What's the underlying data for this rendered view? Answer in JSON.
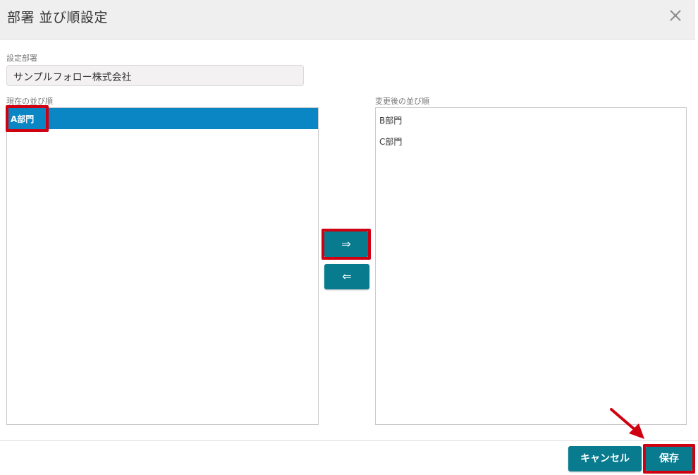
{
  "dialog": {
    "title": "部署 並び順設定"
  },
  "setting_department": {
    "label": "設定部署",
    "value": "サンプルフォロー株式会社"
  },
  "current_order": {
    "label": "現在の並び順",
    "items": [
      {
        "label": "A部門",
        "selected": true
      }
    ]
  },
  "new_order": {
    "label": "変更後の並び順",
    "items": [
      {
        "label": "B部門"
      },
      {
        "label": "C部門"
      }
    ]
  },
  "buttons": {
    "move_right": "⇒",
    "move_left": "⇐",
    "cancel": "キャンセル",
    "save": "保存"
  },
  "colors": {
    "accent": "#087b8f",
    "selection": "#0b86c4",
    "annotation": "#d00010"
  },
  "icons": {
    "close": "close-icon",
    "annotation_arrow": "annotation-arrow-icon"
  }
}
